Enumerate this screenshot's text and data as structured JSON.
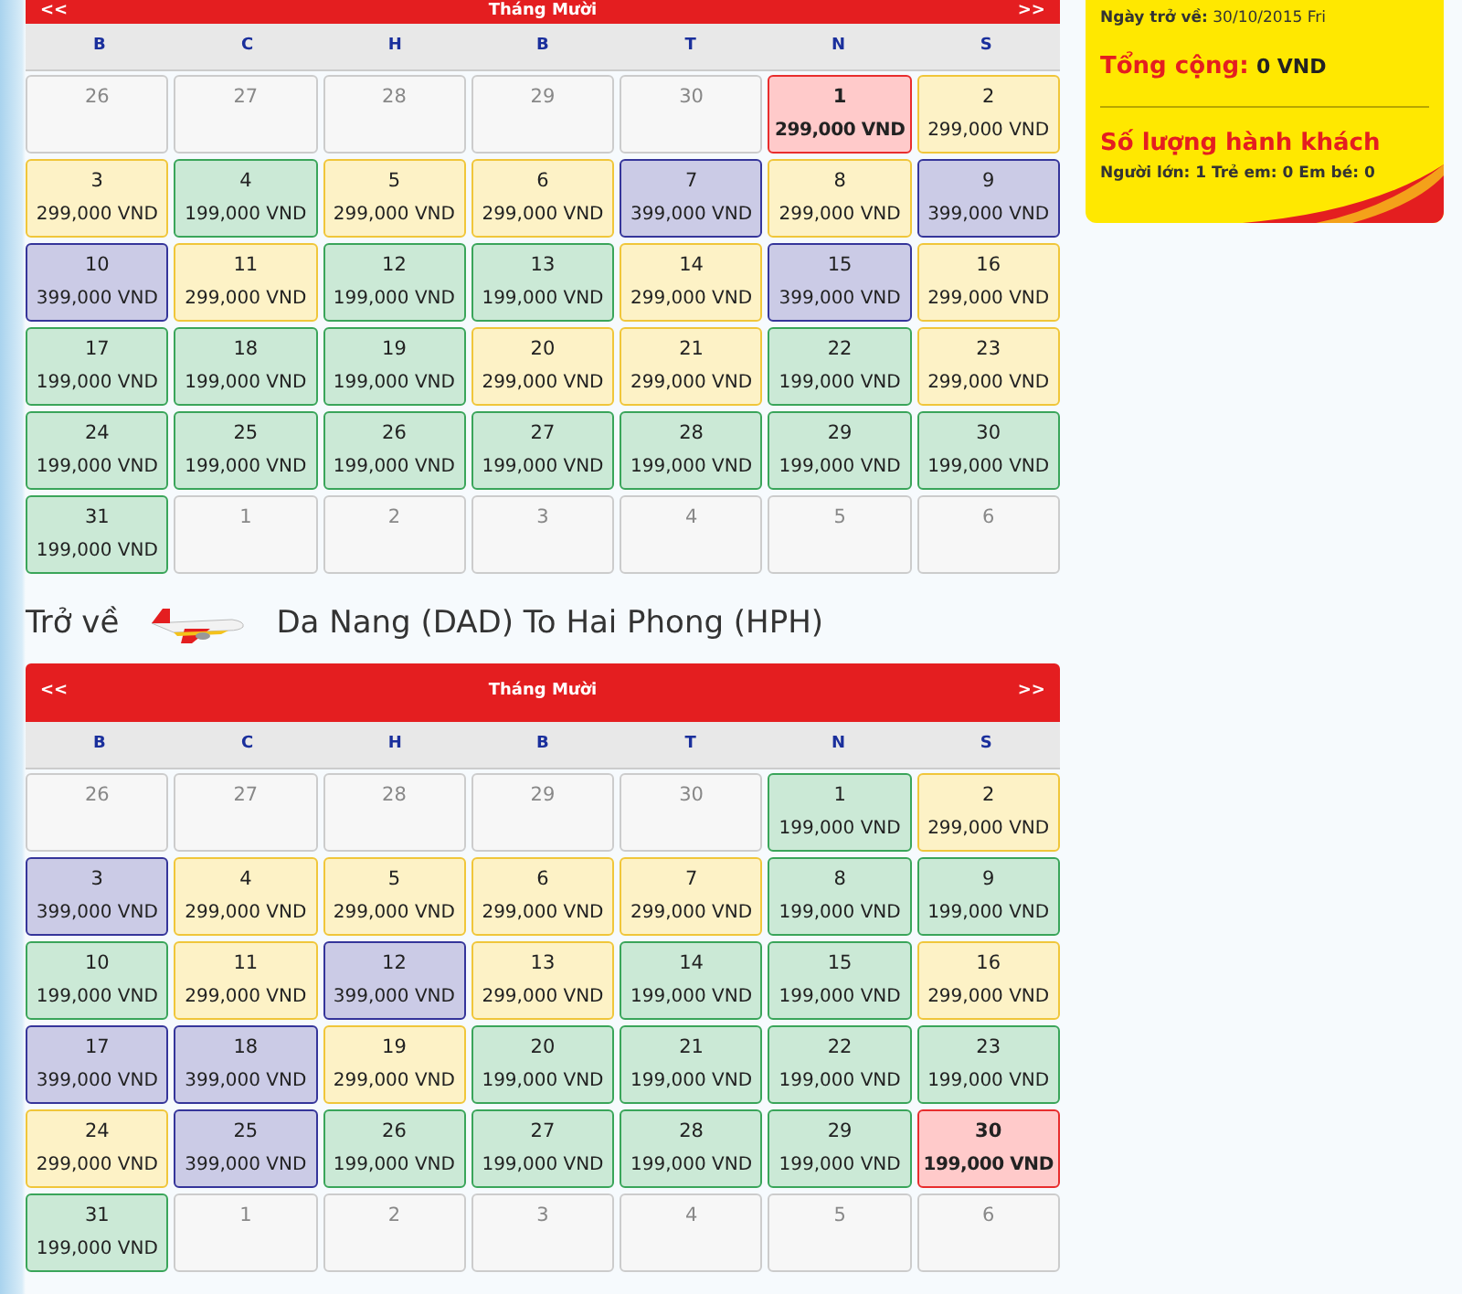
{
  "calendars": [
    {
      "header": {
        "prev": "<<",
        "month": "Tháng Mười",
        "next": ">>"
      },
      "weekdays": [
        "B",
        "C",
        "H",
        "B",
        "T",
        "N",
        "S"
      ],
      "weeks": [
        [
          {
            "day": "26",
            "kind": "other",
            "selected": false
          },
          {
            "day": "27",
            "kind": "other",
            "selected": false
          },
          {
            "day": "28",
            "kind": "other",
            "selected": false
          },
          {
            "day": "29",
            "kind": "other",
            "selected": false
          },
          {
            "day": "30",
            "kind": "other",
            "selected": false
          },
          {
            "day": "1",
            "price": "299,000 VND",
            "kind": "mid",
            "selected": true
          },
          {
            "day": "2",
            "price": "299,000 VND",
            "kind": "mid",
            "selected": false
          }
        ],
        [
          {
            "day": "3",
            "price": "299,000 VND",
            "kind": "mid",
            "selected": false
          },
          {
            "day": "4",
            "price": "199,000 VND",
            "kind": "low",
            "selected": false
          },
          {
            "day": "5",
            "price": "299,000 VND",
            "kind": "mid",
            "selected": false
          },
          {
            "day": "6",
            "price": "299,000 VND",
            "kind": "mid",
            "selected": false
          },
          {
            "day": "7",
            "price": "399,000 VND",
            "kind": "high",
            "selected": false
          },
          {
            "day": "8",
            "price": "299,000 VND",
            "kind": "mid",
            "selected": false
          },
          {
            "day": "9",
            "price": "399,000 VND",
            "kind": "high",
            "selected": false
          }
        ],
        [
          {
            "day": "10",
            "price": "399,000 VND",
            "kind": "high",
            "selected": false
          },
          {
            "day": "11",
            "price": "299,000 VND",
            "kind": "mid",
            "selected": false
          },
          {
            "day": "12",
            "price": "199,000 VND",
            "kind": "low",
            "selected": false
          },
          {
            "day": "13",
            "price": "199,000 VND",
            "kind": "low",
            "selected": false
          },
          {
            "day": "14",
            "price": "299,000 VND",
            "kind": "mid",
            "selected": false
          },
          {
            "day": "15",
            "price": "399,000 VND",
            "kind": "high",
            "selected": false
          },
          {
            "day": "16",
            "price": "299,000 VND",
            "kind": "mid",
            "selected": false
          }
        ],
        [
          {
            "day": "17",
            "price": "199,000 VND",
            "kind": "low",
            "selected": false
          },
          {
            "day": "18",
            "price": "199,000 VND",
            "kind": "low",
            "selected": false
          },
          {
            "day": "19",
            "price": "199,000 VND",
            "kind": "low",
            "selected": false
          },
          {
            "day": "20",
            "price": "299,000 VND",
            "kind": "mid",
            "selected": false
          },
          {
            "day": "21",
            "price": "299,000 VND",
            "kind": "mid",
            "selected": false
          },
          {
            "day": "22",
            "price": "199,000 VND",
            "kind": "low",
            "selected": false
          },
          {
            "day": "23",
            "price": "299,000 VND",
            "kind": "mid",
            "selected": false
          }
        ],
        [
          {
            "day": "24",
            "price": "199,000 VND",
            "kind": "low",
            "selected": false
          },
          {
            "day": "25",
            "price": "199,000 VND",
            "kind": "low",
            "selected": false
          },
          {
            "day": "26",
            "price": "199,000 VND",
            "kind": "low",
            "selected": false
          },
          {
            "day": "27",
            "price": "199,000 VND",
            "kind": "low",
            "selected": false
          },
          {
            "day": "28",
            "price": "199,000 VND",
            "kind": "low",
            "selected": false
          },
          {
            "day": "29",
            "price": "199,000 VND",
            "kind": "low",
            "selected": false
          },
          {
            "day": "30",
            "price": "199,000 VND",
            "kind": "low",
            "selected": false
          }
        ],
        [
          {
            "day": "31",
            "price": "199,000 VND",
            "kind": "low",
            "selected": false
          },
          {
            "day": "1",
            "kind": "other",
            "selected": false
          },
          {
            "day": "2",
            "kind": "other",
            "selected": false
          },
          {
            "day": "3",
            "kind": "other",
            "selected": false
          },
          {
            "day": "4",
            "kind": "other",
            "selected": false
          },
          {
            "day": "5",
            "kind": "other",
            "selected": false
          },
          {
            "day": "6",
            "kind": "other",
            "selected": false
          }
        ]
      ]
    },
    {
      "title": {
        "label": "Trở về",
        "route": "Da Nang (DAD) To Hai Phong (HPH)"
      },
      "header": {
        "prev": "<<",
        "month": "Tháng Mười",
        "next": ">>"
      },
      "weekdays": [
        "B",
        "C",
        "H",
        "B",
        "T",
        "N",
        "S"
      ],
      "weeks": [
        [
          {
            "day": "26",
            "kind": "other",
            "selected": false
          },
          {
            "day": "27",
            "kind": "other",
            "selected": false
          },
          {
            "day": "28",
            "kind": "other",
            "selected": false
          },
          {
            "day": "29",
            "kind": "other",
            "selected": false
          },
          {
            "day": "30",
            "kind": "other",
            "selected": false
          },
          {
            "day": "1",
            "price": "199,000 VND",
            "kind": "low",
            "selected": false
          },
          {
            "day": "2",
            "price": "299,000 VND",
            "kind": "mid",
            "selected": false
          }
        ],
        [
          {
            "day": "3",
            "price": "399,000 VND",
            "kind": "high",
            "selected": false
          },
          {
            "day": "4",
            "price": "299,000 VND",
            "kind": "mid",
            "selected": false
          },
          {
            "day": "5",
            "price": "299,000 VND",
            "kind": "mid",
            "selected": false
          },
          {
            "day": "6",
            "price": "299,000 VND",
            "kind": "mid",
            "selected": false
          },
          {
            "day": "7",
            "price": "299,000 VND",
            "kind": "mid",
            "selected": false
          },
          {
            "day": "8",
            "price": "199,000 VND",
            "kind": "low",
            "selected": false
          },
          {
            "day": "9",
            "price": "199,000 VND",
            "kind": "low",
            "selected": false
          }
        ],
        [
          {
            "day": "10",
            "price": "199,000 VND",
            "kind": "low",
            "selected": false
          },
          {
            "day": "11",
            "price": "299,000 VND",
            "kind": "mid",
            "selected": false
          },
          {
            "day": "12",
            "price": "399,000 VND",
            "kind": "high",
            "selected": false
          },
          {
            "day": "13",
            "price": "299,000 VND",
            "kind": "mid",
            "selected": false
          },
          {
            "day": "14",
            "price": "199,000 VND",
            "kind": "low",
            "selected": false
          },
          {
            "day": "15",
            "price": "199,000 VND",
            "kind": "low",
            "selected": false
          },
          {
            "day": "16",
            "price": "299,000 VND",
            "kind": "mid",
            "selected": false
          }
        ],
        [
          {
            "day": "17",
            "price": "399,000 VND",
            "kind": "high",
            "selected": false
          },
          {
            "day": "18",
            "price": "399,000 VND",
            "kind": "high",
            "selected": false
          },
          {
            "day": "19",
            "price": "299,000 VND",
            "kind": "mid",
            "selected": false
          },
          {
            "day": "20",
            "price": "199,000 VND",
            "kind": "low",
            "selected": false
          },
          {
            "day": "21",
            "price": "199,000 VND",
            "kind": "low",
            "selected": false
          },
          {
            "day": "22",
            "price": "199,000 VND",
            "kind": "low",
            "selected": false
          },
          {
            "day": "23",
            "price": "199,000 VND",
            "kind": "low",
            "selected": false
          }
        ],
        [
          {
            "day": "24",
            "price": "299,000 VND",
            "kind": "mid",
            "selected": false
          },
          {
            "day": "25",
            "price": "399,000 VND",
            "kind": "high",
            "selected": false
          },
          {
            "day": "26",
            "price": "199,000 VND",
            "kind": "low",
            "selected": false
          },
          {
            "day": "27",
            "price": "199,000 VND",
            "kind": "low",
            "selected": false
          },
          {
            "day": "28",
            "price": "199,000 VND",
            "kind": "low",
            "selected": false
          },
          {
            "day": "29",
            "price": "199,000 VND",
            "kind": "low",
            "selected": false
          },
          {
            "day": "30",
            "price": "199,000 VND",
            "kind": "low",
            "selected": true
          }
        ],
        [
          {
            "day": "31",
            "price": "199,000 VND",
            "kind": "low",
            "selected": false
          },
          {
            "day": "1",
            "kind": "other",
            "selected": false
          },
          {
            "day": "2",
            "kind": "other",
            "selected": false
          },
          {
            "day": "3",
            "kind": "other",
            "selected": false
          },
          {
            "day": "4",
            "kind": "other",
            "selected": false
          },
          {
            "day": "5",
            "kind": "other",
            "selected": false
          },
          {
            "day": "6",
            "kind": "other",
            "selected": false
          }
        ]
      ]
    }
  ],
  "summary": {
    "return_date_label": "Ngày trở về:",
    "return_date": "30/10/2015 Fri",
    "total_label": "Tổng cộng:",
    "total": "0 VND",
    "passengers_title": "Số lượng hành khách",
    "passengers": [
      {
        "label": "Người lớn:",
        "count": "1"
      },
      {
        "label": "Trẻ em:",
        "count": "0"
      },
      {
        "label": "Em bé:",
        "count": "0"
      }
    ]
  }
}
